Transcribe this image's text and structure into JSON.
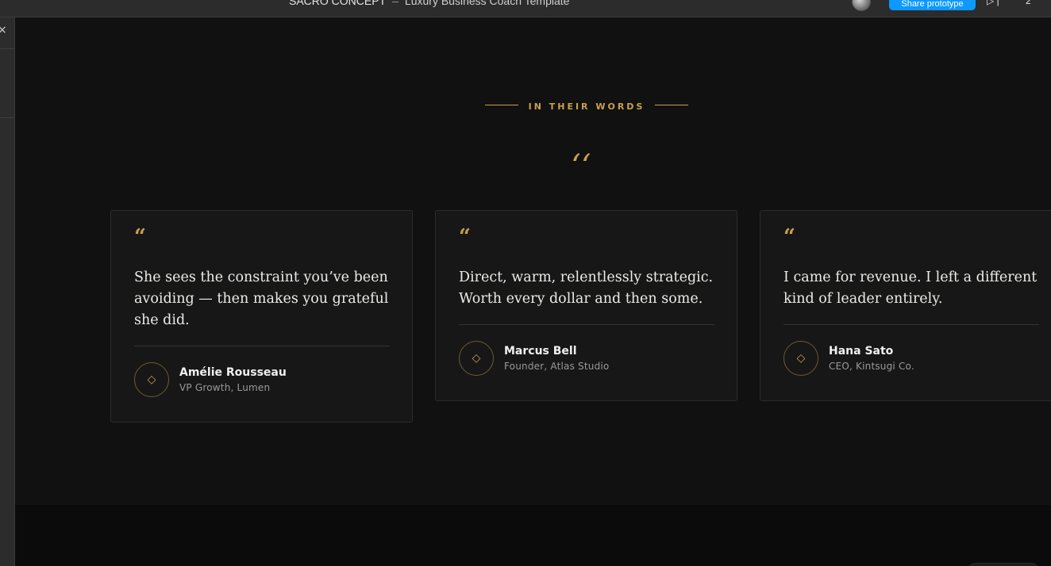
{
  "editor": {
    "file_title": "SACRO CONCEPT",
    "separator": "–",
    "file_subtitle": "Luxury Business Coach Template",
    "share_label": "Share prototype",
    "play_label": "▷ |",
    "zoom_label": "2",
    "close_symbol": "×"
  },
  "section": {
    "eyebrow": "IN THEIR WORDS",
    "big_quote_glyph": "‘‘"
  },
  "testimonials": [
    {
      "quote_glyph": "“",
      "quote": "She sees the constraint you’ve been avoiding — then makes you grateful she did.",
      "name": "Amélie Rousseau",
      "role": "VP Growth, Lumen",
      "badge_icon": "◇"
    },
    {
      "quote_glyph": "“",
      "quote": "Direct, warm, relentlessly strategic. Worth every dollar and then some.",
      "name": "Marcus Bell",
      "role": "Founder, Atlas Studio",
      "badge_icon": "◇"
    },
    {
      "quote_glyph": "“",
      "quote": "I came for revenue. I left a different kind of leader entirely.",
      "name": "Hana Sato",
      "role": "CEO, Kintsugi Co.",
      "badge_icon": "◇"
    }
  ],
  "colors": {
    "accent_gold": "#c9a14a",
    "background": "#111111",
    "card_bg": "#171717",
    "share_blue": "#0d99ff"
  }
}
